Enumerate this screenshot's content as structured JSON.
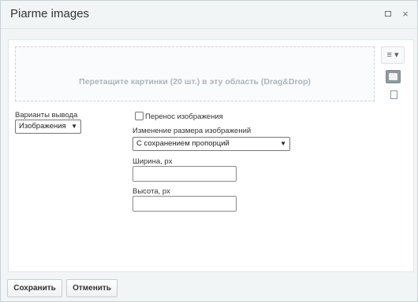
{
  "dialog": {
    "title": "Piarme images",
    "maximize_icon": "maximize-icon",
    "close_icon": "close-icon",
    "close_glyph": "×"
  },
  "dropzone": {
    "text": "Перетащите картинки (20 шт.) в эту область (Drag&Drop)"
  },
  "toolbar": {
    "menu_icon": "menu-icon",
    "menu_glyph": "≡ ▾",
    "image_view_icon": "image-icon",
    "file_view_icon": "file-icon"
  },
  "output": {
    "label": "Варианты вывода",
    "selected": "Изображения"
  },
  "wrap": {
    "label": "Перенос изображения",
    "checked": false
  },
  "resize": {
    "label": "Изменение размера изображений",
    "selected": "С сохранением пропорций"
  },
  "width": {
    "label": "Ширина, px",
    "value": ""
  },
  "height": {
    "label": "Высота, px",
    "value": ""
  },
  "footer": {
    "save_label": "Сохранить",
    "cancel_label": "Отменить"
  },
  "colors": {
    "dialog_bg": "#f2f5f6",
    "dropzone_text": "#a9b5bb"
  }
}
